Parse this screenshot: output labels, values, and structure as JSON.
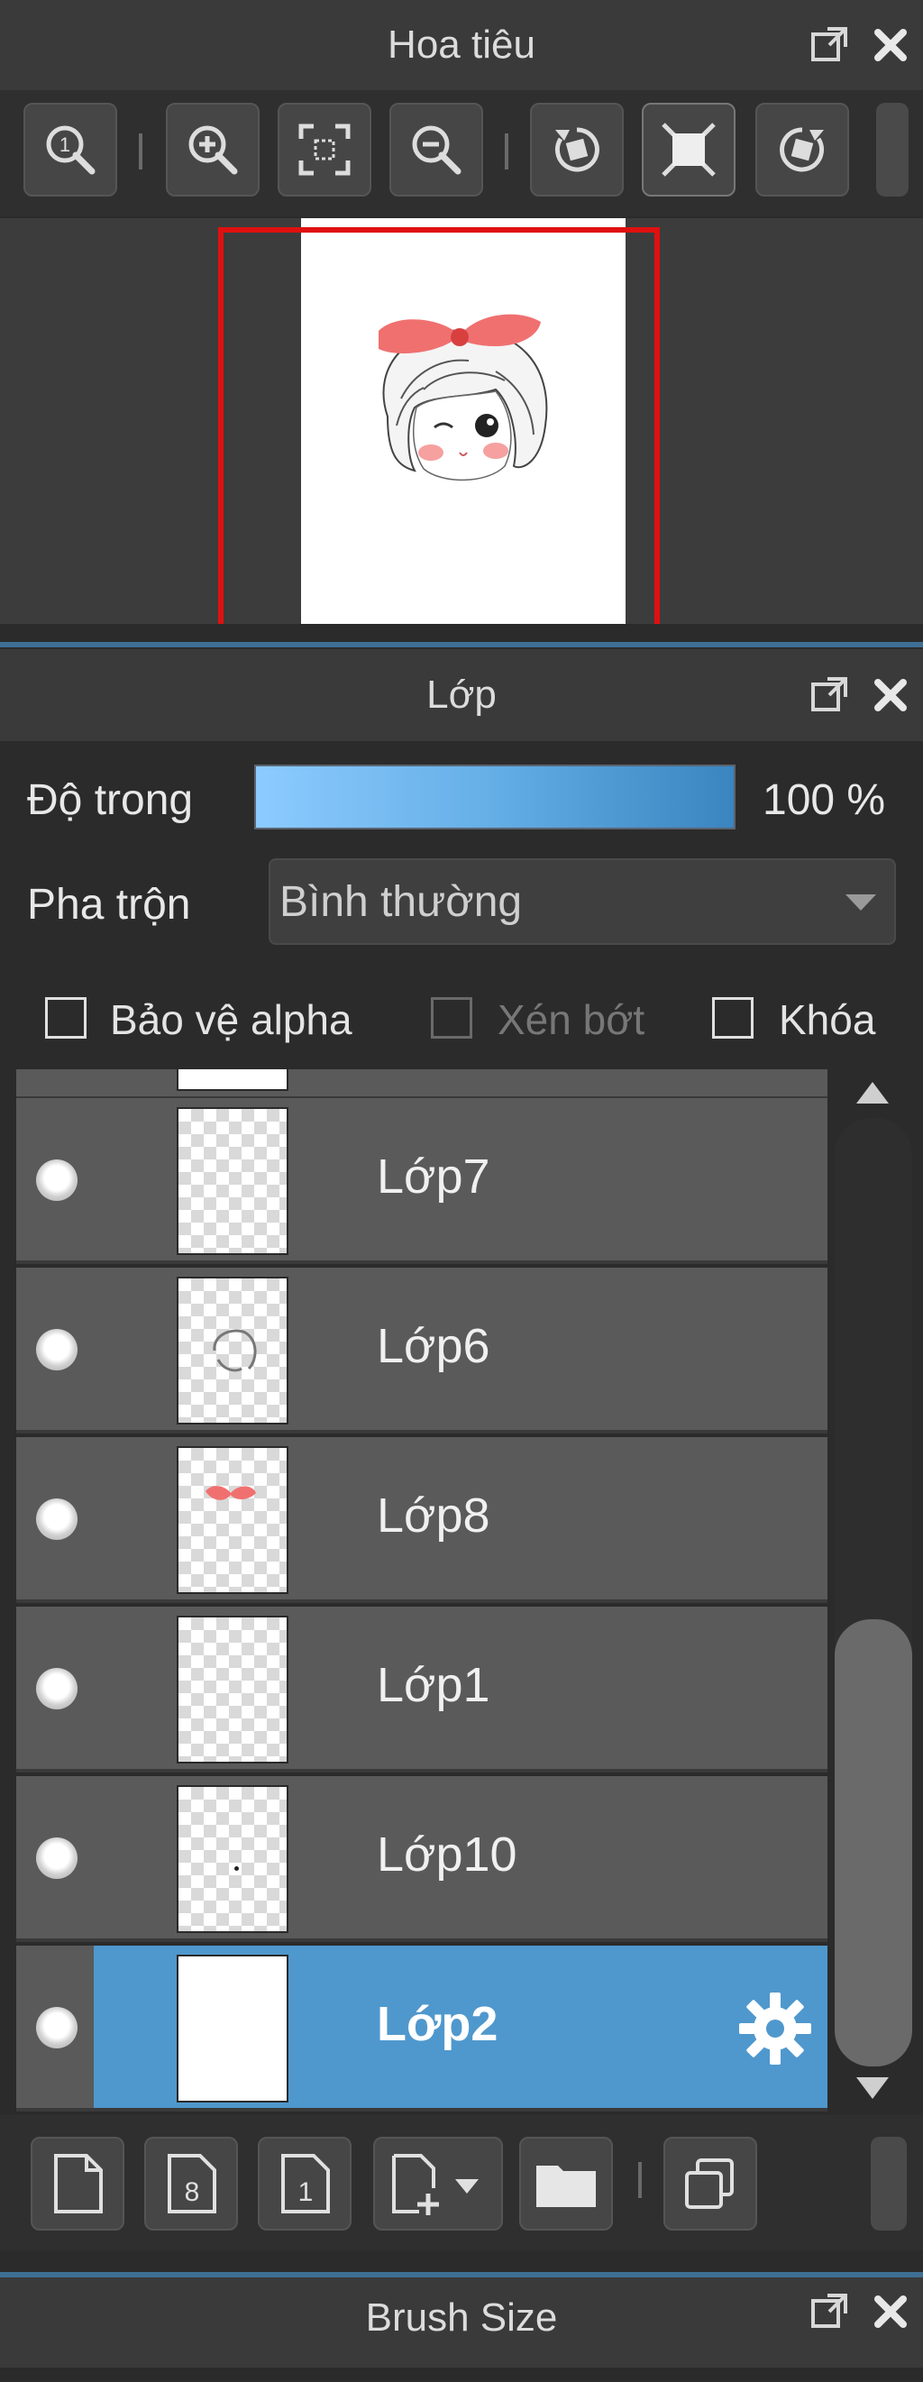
{
  "navigator": {
    "title": "Hoa tiêu",
    "toolbar": [
      {
        "icon": "zoom-actual-icon"
      },
      {
        "icon": "zoom-in-icon"
      },
      {
        "icon": "fit-screen-icon"
      },
      {
        "icon": "zoom-out-icon"
      },
      {
        "icon": "rotate-left-icon"
      },
      {
        "icon": "fullscreen-icon"
      },
      {
        "icon": "rotate-right-icon"
      }
    ]
  },
  "layers": {
    "title": "Lớp",
    "opacity_label": "Độ trong",
    "opacity_value": "100 %",
    "opacity_fraction": 1.0,
    "blend_label": "Pha trộn",
    "blend_value": "Bình thường",
    "checkboxes": {
      "protect_alpha": "Bảo vệ alpha",
      "clip": "Xén bớt",
      "lock": "Khóa"
    },
    "items": [
      {
        "name": "Lớp7",
        "selected": false
      },
      {
        "name": "Lớp6",
        "selected": false
      },
      {
        "name": "Lớp8",
        "selected": false
      },
      {
        "name": "Lớp1",
        "selected": false
      },
      {
        "name": "Lớp10",
        "selected": false
      },
      {
        "name": "Lớp2",
        "selected": true
      }
    ]
  },
  "next_panel": {
    "title": "Brush Size"
  },
  "colors": {
    "selection": "#4f98cd",
    "viewport_frame": "#e01010",
    "panel_bg": "#2b2b2b"
  }
}
